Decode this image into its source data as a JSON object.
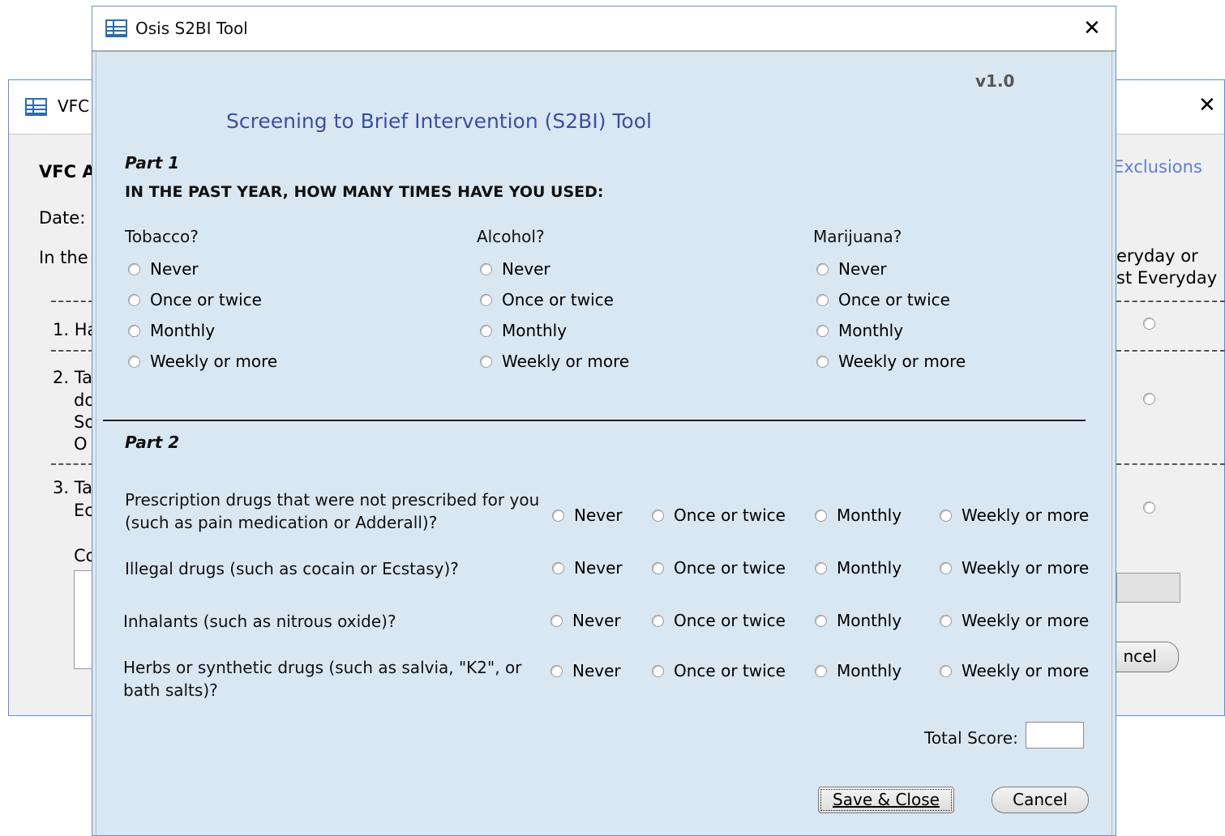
{
  "background_window": {
    "title": "VFC",
    "heading": "VFC A",
    "date_label": "Date:",
    "intro_text": "In the",
    "exclusions_link": "Exclusions",
    "col_header_line1": "eryday or",
    "col_header_line2": "st Everyday",
    "q1": "1. Ha",
    "q2_line1": "2. Ta",
    "q2_line2": "do",
    "q2_line3": "So",
    "q2_line4": "O",
    "q3_line1": "3. Ta",
    "q3_line2": "Ec",
    "comments_label": "Co",
    "cancel_label": "ncel"
  },
  "main_window": {
    "title": "Osis S2BI Tool",
    "version": "v1.0",
    "heading": "Screening to Brief Intervention (S2BI) Tool",
    "part1": {
      "label": "Part 1",
      "question": "IN THE PAST YEAR, HOW MANY TIMES HAVE YOU USED:",
      "substances": [
        {
          "label": "Tobacco?",
          "options": [
            "Never",
            "Once or twice",
            "Monthly",
            "Weekly or more"
          ]
        },
        {
          "label": "Alcohol?",
          "options": [
            "Never",
            "Once or twice",
            "Monthly",
            "Weekly or more"
          ]
        },
        {
          "label": "Marijuana?",
          "options": [
            "Never",
            "Once or twice",
            "Monthly",
            "Weekly or more"
          ]
        }
      ]
    },
    "part2": {
      "label": "Part 2",
      "options": [
        "Never",
        "Once or twice",
        "Monthly",
        "Weekly or more"
      ],
      "questions": [
        {
          "line1": "Prescription drugs that were not prescribed for you",
          "line2": "(such as pain medication or Adderall)?"
        },
        {
          "line1": "Illegal drugs (such as cocain or Ecstasy)?",
          "line2": ""
        },
        {
          "line1": "Inhalants (such as nitrous oxide)?",
          "line2": ""
        },
        {
          "line1": "Herbs or synthetic drugs (such as salvia, \"K2\", or",
          "line2": "bath salts)?"
        }
      ]
    },
    "total_score_label": "Total Score:",
    "total_score_value": "",
    "save_button": "Save & Close",
    "cancel_button": "Cancel"
  },
  "colors": {
    "dialog_background": "#d9e7f3",
    "heading_blue": "#3d4fa0",
    "link_blue": "#5b7fd6"
  }
}
